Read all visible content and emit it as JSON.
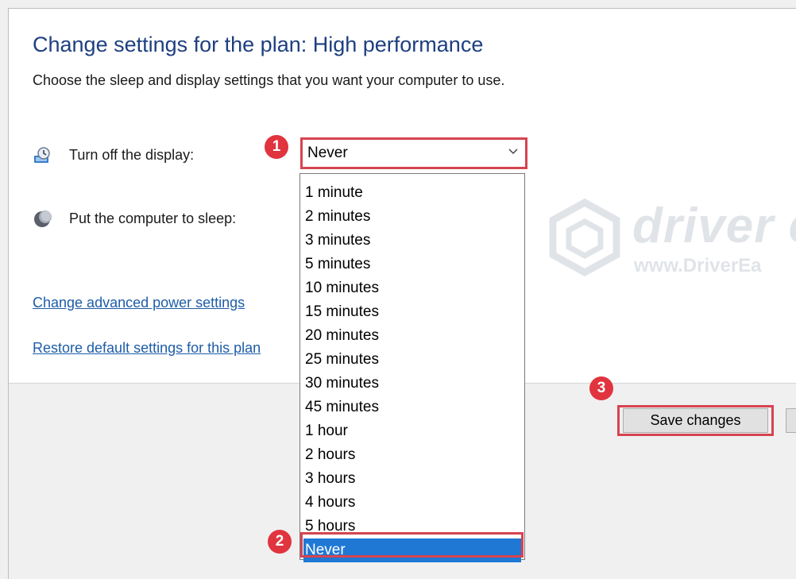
{
  "page": {
    "title": "Change settings for the plan: High performance",
    "subtitle": "Choose the sleep and display settings that you want your computer to use."
  },
  "settings": {
    "display": {
      "label": "Turn off the display:",
      "icon": "monitor-clock-icon",
      "value": "Never"
    },
    "sleep": {
      "label": "Put the computer to sleep:",
      "icon": "sleep-moon-icon"
    }
  },
  "links": {
    "advanced": "Change advanced power settings",
    "restore": "Restore default settings for this plan"
  },
  "dropdown": {
    "options": [
      "1 minute",
      "2 minutes",
      "3 minutes",
      "5 minutes",
      "10 minutes",
      "15 minutes",
      "20 minutes",
      "25 minutes",
      "30 minutes",
      "45 minutes",
      "1 hour",
      "2 hours",
      "3 hours",
      "4 hours",
      "5 hours",
      "Never"
    ],
    "selected": "Never"
  },
  "buttons": {
    "save": "Save changes"
  },
  "annotations": {
    "step1": "1",
    "step2": "2",
    "step3": "3",
    "color": "#d64450"
  },
  "watermark": {
    "brand": "driver e",
    "url": "www.DriverEa"
  },
  "colors": {
    "title": "#1e3f80",
    "link": "#1e5ca8",
    "selection": "#1e78d4"
  }
}
